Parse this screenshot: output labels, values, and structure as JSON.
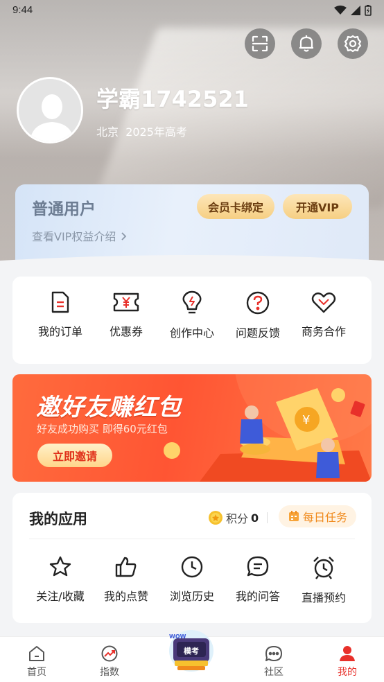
{
  "status": {
    "time": "9:44"
  },
  "profile": {
    "username": "学霸1742521",
    "location": "北京",
    "exam_year": "2025年高考"
  },
  "vip": {
    "tier": "普通用户",
    "benefits_link": "查看VIP权益介绍",
    "bind_card_label": "会员卡绑定",
    "open_vip_label": "开通VIP"
  },
  "quick_actions": [
    {
      "label": "我的订单",
      "icon": "order-document-icon"
    },
    {
      "label": "优惠券",
      "icon": "coupon-icon"
    },
    {
      "label": "创作中心",
      "icon": "lightbulb-icon"
    },
    {
      "label": "问题反馈",
      "icon": "question-icon"
    },
    {
      "label": "商务合作",
      "icon": "handshake-heart-icon"
    }
  ],
  "banner": {
    "title": "邀好友赚红包",
    "subtitle": "好友成功购买 即得60元红包",
    "button_label": "立即邀请"
  },
  "apps": {
    "title": "我的应用",
    "points_label": "积分",
    "points_value": "0",
    "daily_tasks_label": "每日任务",
    "items": [
      {
        "label": "关注/收藏",
        "icon": "star-icon"
      },
      {
        "label": "我的点赞",
        "icon": "thumbs-up-icon"
      },
      {
        "label": "浏览历史",
        "icon": "clock-icon"
      },
      {
        "label": "我的问答",
        "icon": "chat-bubble-icon"
      },
      {
        "label": "直播预约",
        "icon": "alarm-clock-icon"
      }
    ]
  },
  "tabbar": {
    "items": [
      {
        "label": "首页",
        "icon": "home-icon"
      },
      {
        "label": "指数",
        "icon": "trend-icon"
      },
      {
        "label": "",
        "icon": "exam-mascot-icon"
      },
      {
        "label": "社区",
        "icon": "community-icon"
      },
      {
        "label": "我的",
        "icon": "profile-icon"
      }
    ],
    "center_badge": "模考"
  },
  "colors": {
    "accent": "#e8302a",
    "vip_gold": "#f6cf83",
    "banner_red": "#ff5533"
  }
}
